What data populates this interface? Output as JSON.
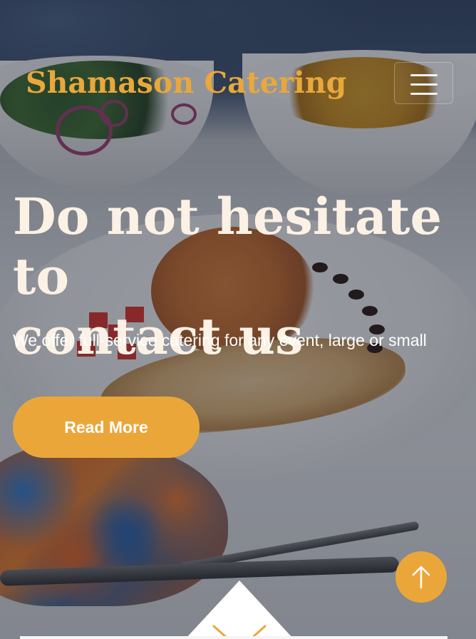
{
  "brand": {
    "name": "Shamason Catering"
  },
  "hero": {
    "headline_line1": "Do not hesitate to",
    "headline_line2": "contact us",
    "subtext": "We offer full-service catering for any event, large or small",
    "cta_label": "Read More"
  },
  "icons": {
    "menu": "hamburger-menu-icon",
    "back_to_top": "arrow-up-icon",
    "scroll_down": "chevron-down-icon"
  },
  "colors": {
    "accent": "#eba63a",
    "brand_text": "#e9a83a",
    "headline": "#fbf1e4",
    "body_text": "#ffffff"
  }
}
